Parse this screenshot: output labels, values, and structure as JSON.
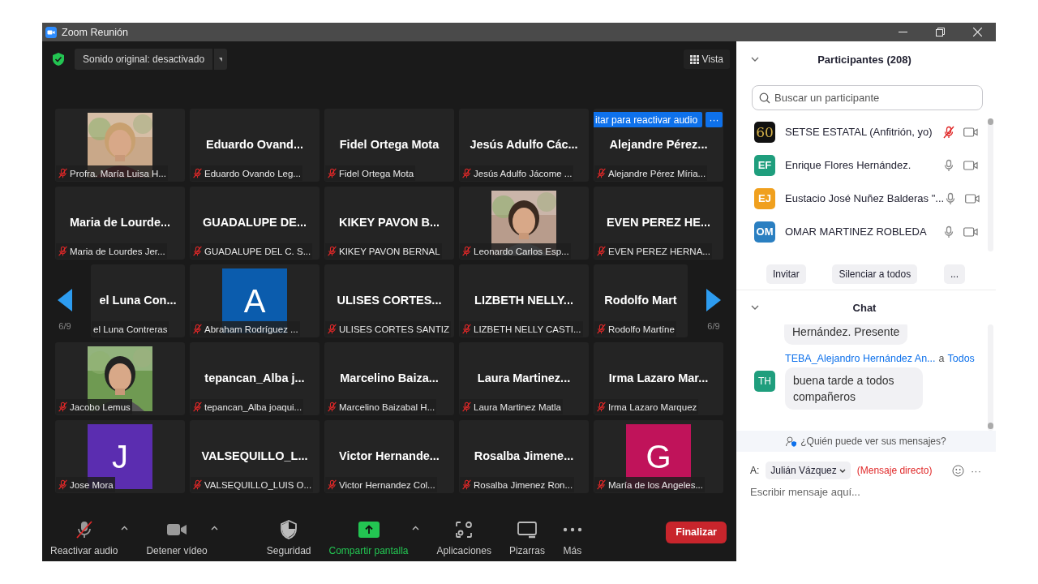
{
  "window": {
    "title": "Zoom Reunión"
  },
  "video_top": {
    "audio_dropdown": "Sonido original: desactivado",
    "view_button": "Vista"
  },
  "gallery": {
    "prev_page": "6/9",
    "next_page": "6/9",
    "tiles": [
      {
        "label": "Profra. María Luisa H...",
        "muted": true
      },
      {
        "kind": "name",
        "display": "Eduardo Ovand...",
        "label": "Eduardo Ovando Leg...",
        "muted": true
      },
      {
        "kind": "name",
        "display": "Fidel Ortega Mota",
        "label": "Fidel Ortega Mota",
        "muted": true
      },
      {
        "kind": "name",
        "display": "Jesús Adulfo Các...",
        "label": "Jesús Adulfo Jácome ...",
        "muted": true
      },
      {
        "kind": "name",
        "display": "Alejandre Pérez...",
        "label": "Alejandre Pérez Míria...",
        "muted": true,
        "banner": "itar para reactivar audio",
        "banner_menu": "···"
      },
      {
        "kind": "name",
        "display": "Maria de Lourde...",
        "label": "Maria de Lourdes Jer...",
        "muted": true
      },
      {
        "kind": "name",
        "display": "GUADALUPE DE...",
        "label": "GUADALUPE DEL C. S...",
        "muted": true
      },
      {
        "kind": "name",
        "display": "KIKEY PAVON B...",
        "label": "KIKEY PAVON BERNAL",
        "muted": true
      },
      {
        "label": "Leonardo Carlos Esp...",
        "muted": true
      },
      {
        "kind": "name",
        "display": "EVEN PEREZ HE...",
        "label": "EVEN PEREZ HERNA...",
        "muted": true
      },
      {
        "kind": "name",
        "display": "el Luna Con...",
        "label": "el Luna Contreras",
        "muted": false,
        "clipped_left": true
      },
      {
        "kind": "letter",
        "letter": "A",
        "color": "#0b5cad",
        "label": "Abraham Rodríguez ...",
        "muted": true
      },
      {
        "kind": "name",
        "display": "ULISES CORTES...",
        "label": "ULISES CORTES SANTIZ",
        "muted": true
      },
      {
        "kind": "name",
        "display": "LIZBETH NELLY...",
        "label": "LIZBETH NELLY CASTI...",
        "muted": true
      },
      {
        "kind": "name",
        "display": "Rodolfo Mart",
        "label": "Rodolfo Martíne",
        "muted": true,
        "clipped_right": true
      },
      {
        "label": "Jacobo Lemus",
        "muted": true
      },
      {
        "kind": "name",
        "display": "tepancan_Alba j...",
        "label": "tepancan_Alba joaqui...",
        "muted": true
      },
      {
        "kind": "name",
        "display": "Marcelino Baiza...",
        "label": "Marcelino Baizabal H...",
        "muted": true
      },
      {
        "kind": "name",
        "display": "Laura Martinez...",
        "label": "Laura Martinez Matla",
        "muted": true
      },
      {
        "kind": "name",
        "display": "Irma Lazaro Mar...",
        "label": "Irma Lazaro Marquez",
        "muted": true
      },
      {
        "kind": "letter",
        "letter": "J",
        "color": "#5b2db0",
        "label": "Jose Mora",
        "muted": true
      },
      {
        "kind": "name",
        "display": "VALSEQUILLO_L...",
        "label": "VALSEQUILLO_LUIS O...",
        "muted": true
      },
      {
        "kind": "name",
        "display": "Victor Hernande...",
        "label": "Victor Hernandez Col...",
        "muted": true
      },
      {
        "kind": "name",
        "display": "Rosalba Jimene...",
        "label": "Rosalba Jimenez Ron...",
        "muted": true
      },
      {
        "kind": "letter",
        "letter": "G",
        "color": "#c0135a",
        "label": "María de los Angeles...",
        "muted": true
      }
    ]
  },
  "toolbar": {
    "items": [
      {
        "kind": "mic",
        "label": "Reactivar audio",
        "muted": true,
        "caret": true
      },
      {
        "kind": "video",
        "label": "Detener vídeo",
        "caret": true
      },
      {
        "kind": "shield",
        "label": "Seguridad"
      },
      {
        "kind": "share",
        "label": "Compartir pantalla",
        "caret": true
      },
      {
        "kind": "apps",
        "label": "Aplicaciones"
      },
      {
        "kind": "board",
        "label": "Pizarras"
      },
      {
        "kind": "more",
        "label": "Más"
      }
    ],
    "end_button": "Finalizar"
  },
  "participants": {
    "title": "Participantes (208)",
    "search_placeholder": "Buscar un participante",
    "items": [
      {
        "kind": "logo",
        "avatar": "60",
        "color": "#111111",
        "name": "SETSE ESTATAL (Anfitrión, yo)",
        "muted": true
      },
      {
        "kind": "initials",
        "avatar": "EF",
        "color": "#1f9e7d",
        "name": "Enrique Flores Hernández.",
        "muted": false
      },
      {
        "kind": "initials",
        "avatar": "EJ",
        "color": "#f0a01e",
        "name": "Eustacio José Nuñez Balderas \"...",
        "muted": false
      },
      {
        "kind": "initials",
        "avatar": "OM",
        "color": "#2a7fc1",
        "name": "OMAR MARTINEZ ROBLEDA",
        "muted": false
      }
    ],
    "buttons": [
      "Invitar",
      "Silenciar a todos",
      "..."
    ]
  },
  "chat": {
    "title": "Chat",
    "messages": [
      {
        "text": "Hernández. Presente"
      },
      {
        "sender": "TEBA_Alejandro Hernández An...",
        "to_word": "a",
        "recipient": "Todos",
        "avatar": "TH",
        "color": "#1f9e7d",
        "text": "buena tarde a todos compañeros"
      }
    ],
    "visibility_hint": "¿Quién puede ver sus mensajes?",
    "composer": {
      "to_label": "A:",
      "recipient": "Julián Vázquez",
      "mode": "(Mensaje directo)",
      "more": "···",
      "placeholder": "Escribir mensaje aquí..."
    }
  }
}
